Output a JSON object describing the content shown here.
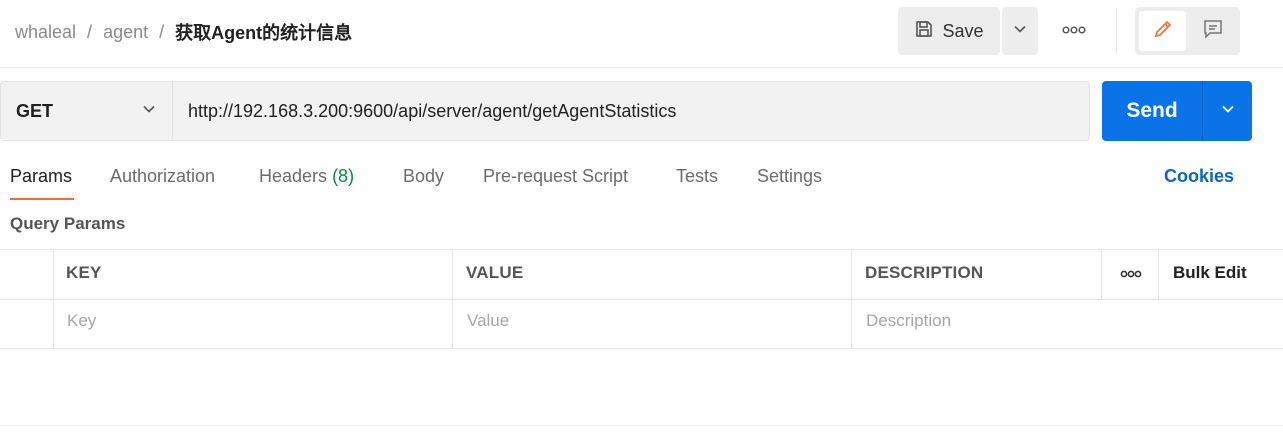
{
  "breadcrumb": {
    "workspace": "whaleal",
    "collection": "agent",
    "separator": "/",
    "request_name": "获取Agent的统计信息"
  },
  "toolbar": {
    "save_label": "Save"
  },
  "request": {
    "method": "GET",
    "url": "http://192.168.3.200:9600/api/server/agent/getAgentStatistics",
    "send_label": "Send"
  },
  "tabs": [
    {
      "label": "Params"
    },
    {
      "label": "Authorization"
    },
    {
      "label": "Headers",
      "count": "(8)"
    },
    {
      "label": "Body"
    },
    {
      "label": "Pre-request Script"
    },
    {
      "label": "Tests"
    },
    {
      "label": "Settings"
    }
  ],
  "active_tab": "Params",
  "cookies_label": "Cookies",
  "query_params": {
    "title": "Query Params",
    "columns": [
      "KEY",
      "VALUE",
      "DESCRIPTION"
    ],
    "bulk_edit_label": "Bulk Edit",
    "placeholders": {
      "key": "Key",
      "value": "Value",
      "description": "Description"
    }
  },
  "colors": {
    "accent_orange": "#f26b3a",
    "send_blue": "#0b73e8",
    "link_blue": "#0b65c2",
    "count_green": "#0c8a3e"
  },
  "icons": [
    "save-icon",
    "chevron-down-icon",
    "more-horizontal-icon",
    "pencil-icon",
    "comment-icon"
  ]
}
